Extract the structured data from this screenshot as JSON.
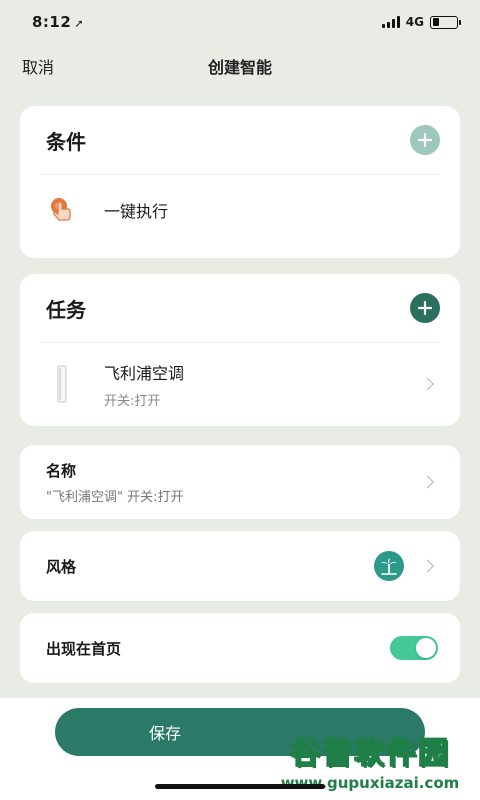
{
  "status_bar": {
    "time": "8:12",
    "network": "4G"
  },
  "nav": {
    "cancel_label": "取消",
    "title": "创建智能"
  },
  "condition_card": {
    "title": "条件",
    "item_label": "一键执行",
    "add_color": "#9cc7bd"
  },
  "task_card": {
    "title": "任务",
    "device_name": "飞利浦空调",
    "device_action": "开关:打开",
    "add_color": "#2b6f5f"
  },
  "name_card": {
    "label": "名称",
    "value": "\"飞利浦空调\" 开关:打开"
  },
  "style_card": {
    "label": "风格",
    "icon": "beach-palm-icon",
    "icon_color": "#2b9a89"
  },
  "home_card": {
    "label": "出现在首页",
    "toggle_on": true,
    "toggle_color": "#44c896"
  },
  "save_label": "保存",
  "watermark": {
    "brand": "谷普软件园",
    "url": "www.gupuxiazai.com"
  }
}
